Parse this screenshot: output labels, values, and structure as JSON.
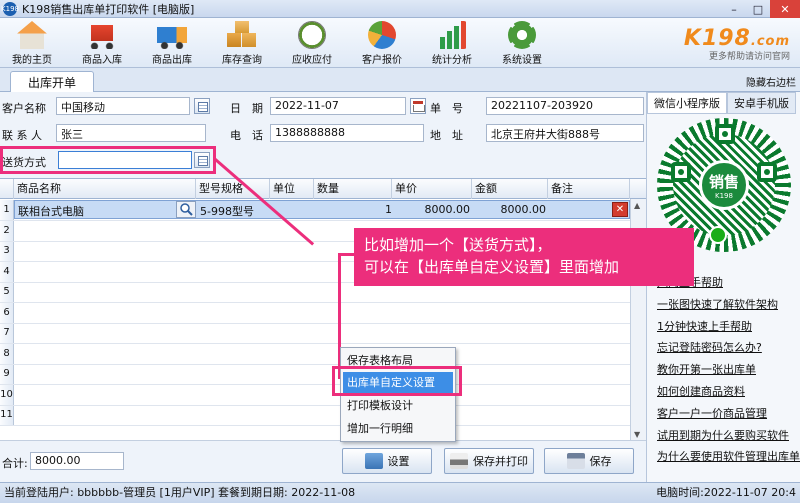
{
  "window": {
    "title": "K198销售出库单打印软件 [电脑版]",
    "icon_label": "K198",
    "controls": [
      "minimize-icon",
      "maximize-icon",
      "close-icon"
    ]
  },
  "toolbar": {
    "items": [
      {
        "label": "我的主页",
        "icon": "home-icon"
      },
      {
        "label": "商品入库",
        "icon": "cart-icon"
      },
      {
        "label": "商品出库",
        "icon": "truck-icon"
      },
      {
        "label": "库存查询",
        "icon": "boxes-icon"
      },
      {
        "label": "应收应付",
        "icon": "clock-icon"
      },
      {
        "label": "客户报价",
        "icon": "chart-pie-icon"
      },
      {
        "label": "统计分析",
        "icon": "bar-chart-icon"
      },
      {
        "label": "系统设置",
        "icon": "gear-icon"
      }
    ],
    "brand_logo": "K198",
    "brand_suffix": ".com",
    "brand_sub": "更多帮助请访问官网"
  },
  "tabs": {
    "active": "出库开单",
    "hide_right": "隐藏右边栏"
  },
  "form": {
    "customer_label": "客户名称",
    "customer_value": "中国移动",
    "date_label": "日　期",
    "date_value": "2022-11-07",
    "order_label": "单　号",
    "order_value": "20221107-203920",
    "contact_label": "联 系 人",
    "contact_value": "张三",
    "phone_label": "电　话",
    "phone_value": "1388888888",
    "address_label": "地　址",
    "address_value": "北京王府井大街888号",
    "delivery_label": "送货方式",
    "delivery_value": ""
  },
  "grid": {
    "headers": [
      "商品名称",
      "型号规格",
      "单位",
      "数量",
      "单价",
      "金额",
      "备注"
    ],
    "row_numbers": [
      "1",
      "2",
      "3",
      "4",
      "5",
      "6",
      "7",
      "8",
      "9",
      "10",
      "11"
    ],
    "rows": [
      {
        "name": "联相台式电脑",
        "model": "5-998型号",
        "unit": "",
        "qty": "1",
        "price": "8000.00",
        "amount": "8000.00",
        "note": ""
      }
    ]
  },
  "context_menu": {
    "items": [
      "保存表格布局",
      "出库单自定义设置",
      "打印模板设计",
      "增加一行明细"
    ],
    "selected_index": 1
  },
  "callout": {
    "line1": "比如增加一个【送货方式】，",
    "line2": "可以在【出库单自定义设置】里面增加"
  },
  "bottom": {
    "total_label": "合计:",
    "total_value": "8000.00",
    "settings_button": "设置",
    "save_print_button": "保存并打印",
    "save_button": "保存"
  },
  "right_panel": {
    "tab_miniprogram": "微信小程序版",
    "tab_android": "安卓手机版",
    "qr_center": "销售",
    "qr_center_sub": "K198",
    "help_links": [
      "入门上手帮助",
      "一张图快速了解软件架构",
      "1分钟快速上手帮助",
      "忘记登陆密码怎么办?",
      "教你开第一张出库单",
      "如何创建商品资料",
      "客户一户一价商品管理",
      "试用到期为什么要购买软件",
      "为什么要使用软件管理出库单"
    ]
  },
  "status": {
    "left": "当前登陆用户:  bbbbbb-管理员  [1用户VIP]  套餐到期日期:  2022-11-08",
    "right": "电脑时间:2022-11-07 20:4"
  },
  "colors": {
    "annotation": "#ec2e7c",
    "menu_selected": "#3d8ee6",
    "brand": "#f08a1c"
  }
}
